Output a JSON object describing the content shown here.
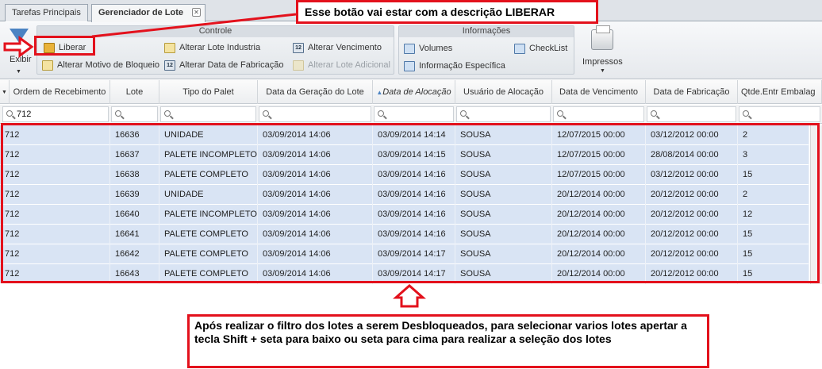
{
  "tabs": [
    {
      "label": "Tarefas Principais"
    },
    {
      "label": "Gerenciador de Lote"
    }
  ],
  "toolbar": {
    "filter_label": "Exibir",
    "controle": {
      "title": "Controle",
      "buttons": [
        {
          "label": "Liberar",
          "icon": "lock-icon"
        },
        {
          "label": "Alterar Motivo de Bloqueio",
          "icon": "edit-icon"
        },
        {
          "label": "Alterar Lote Industria",
          "icon": "edit-icon"
        },
        {
          "label": "Alterar Data de Fabricação",
          "icon": "calendar-icon"
        },
        {
          "label": "Alterar Vencimento",
          "icon": "calendar-icon"
        },
        {
          "label": "Alterar Lote Adicional",
          "icon": "edit-icon"
        }
      ]
    },
    "informacoes": {
      "title": "Informações",
      "buttons": [
        {
          "label": "Volumes",
          "icon": "list-icon"
        },
        {
          "label": "CheckList",
          "icon": "list-icon"
        },
        {
          "label": "Informação Específica",
          "icon": "list-icon"
        }
      ]
    },
    "impressos_label": "Impressos"
  },
  "grid": {
    "columns": [
      "Ordem de Recebimento",
      "Lote",
      "Tipo do Palet",
      "Data da Geração do Lote",
      "Data de Alocação",
      "Usuário de Alocação",
      "Data de Vencimento",
      "Data de Fabricação",
      "Qtde.Entr Embalag"
    ],
    "sorted_column_marker": "▲",
    "filter_value": "712",
    "rows": [
      [
        "712",
        "16636",
        "UNIDADE",
        "03/09/2014 14:06",
        "03/09/2014 14:14",
        "SOUSA",
        "12/07/2015 00:00",
        "03/12/2012 00:00",
        "2"
      ],
      [
        "712",
        "16637",
        "PALETE INCOMPLETO",
        "03/09/2014 14:06",
        "03/09/2014 14:15",
        "SOUSA",
        "12/07/2015 00:00",
        "28/08/2014 00:00",
        "3"
      ],
      [
        "712",
        "16638",
        "PALETE COMPLETO",
        "03/09/2014 14:06",
        "03/09/2014 14:16",
        "SOUSA",
        "12/07/2015 00:00",
        "03/12/2012 00:00",
        "15"
      ],
      [
        "712",
        "16639",
        "UNIDADE",
        "03/09/2014 14:06",
        "03/09/2014 14:16",
        "SOUSA",
        "20/12/2014 00:00",
        "20/12/2012 00:00",
        "2"
      ],
      [
        "712",
        "16640",
        "PALETE INCOMPLETO",
        "03/09/2014 14:06",
        "03/09/2014 14:16",
        "SOUSA",
        "20/12/2014 00:00",
        "20/12/2012 00:00",
        "12"
      ],
      [
        "712",
        "16641",
        "PALETE COMPLETO",
        "03/09/2014 14:06",
        "03/09/2014 14:16",
        "SOUSA",
        "20/12/2014 00:00",
        "20/12/2012 00:00",
        "15"
      ],
      [
        "712",
        "16642",
        "PALETE COMPLETO",
        "03/09/2014 14:06",
        "03/09/2014 14:17",
        "SOUSA",
        "20/12/2014 00:00",
        "20/12/2012 00:00",
        "15"
      ],
      [
        "712",
        "16643",
        "PALETE COMPLETO",
        "03/09/2014 14:06",
        "03/09/2014 14:17",
        "SOUSA",
        "20/12/2014 00:00",
        "20/12/2012 00:00",
        "15"
      ]
    ]
  },
  "annotations": {
    "top": "Esse botão vai estar com a descrição LIBERAR",
    "bottom": "Após realizar o filtro dos lotes a serem Desbloqueados, para selecionar varios lotes apertar a tecla Shift + seta para baixo ou seta para cima para realizar a seleção dos lotes"
  },
  "colors": {
    "annotation_red": "#e3111c",
    "selected_row": "#d9e4f4"
  }
}
